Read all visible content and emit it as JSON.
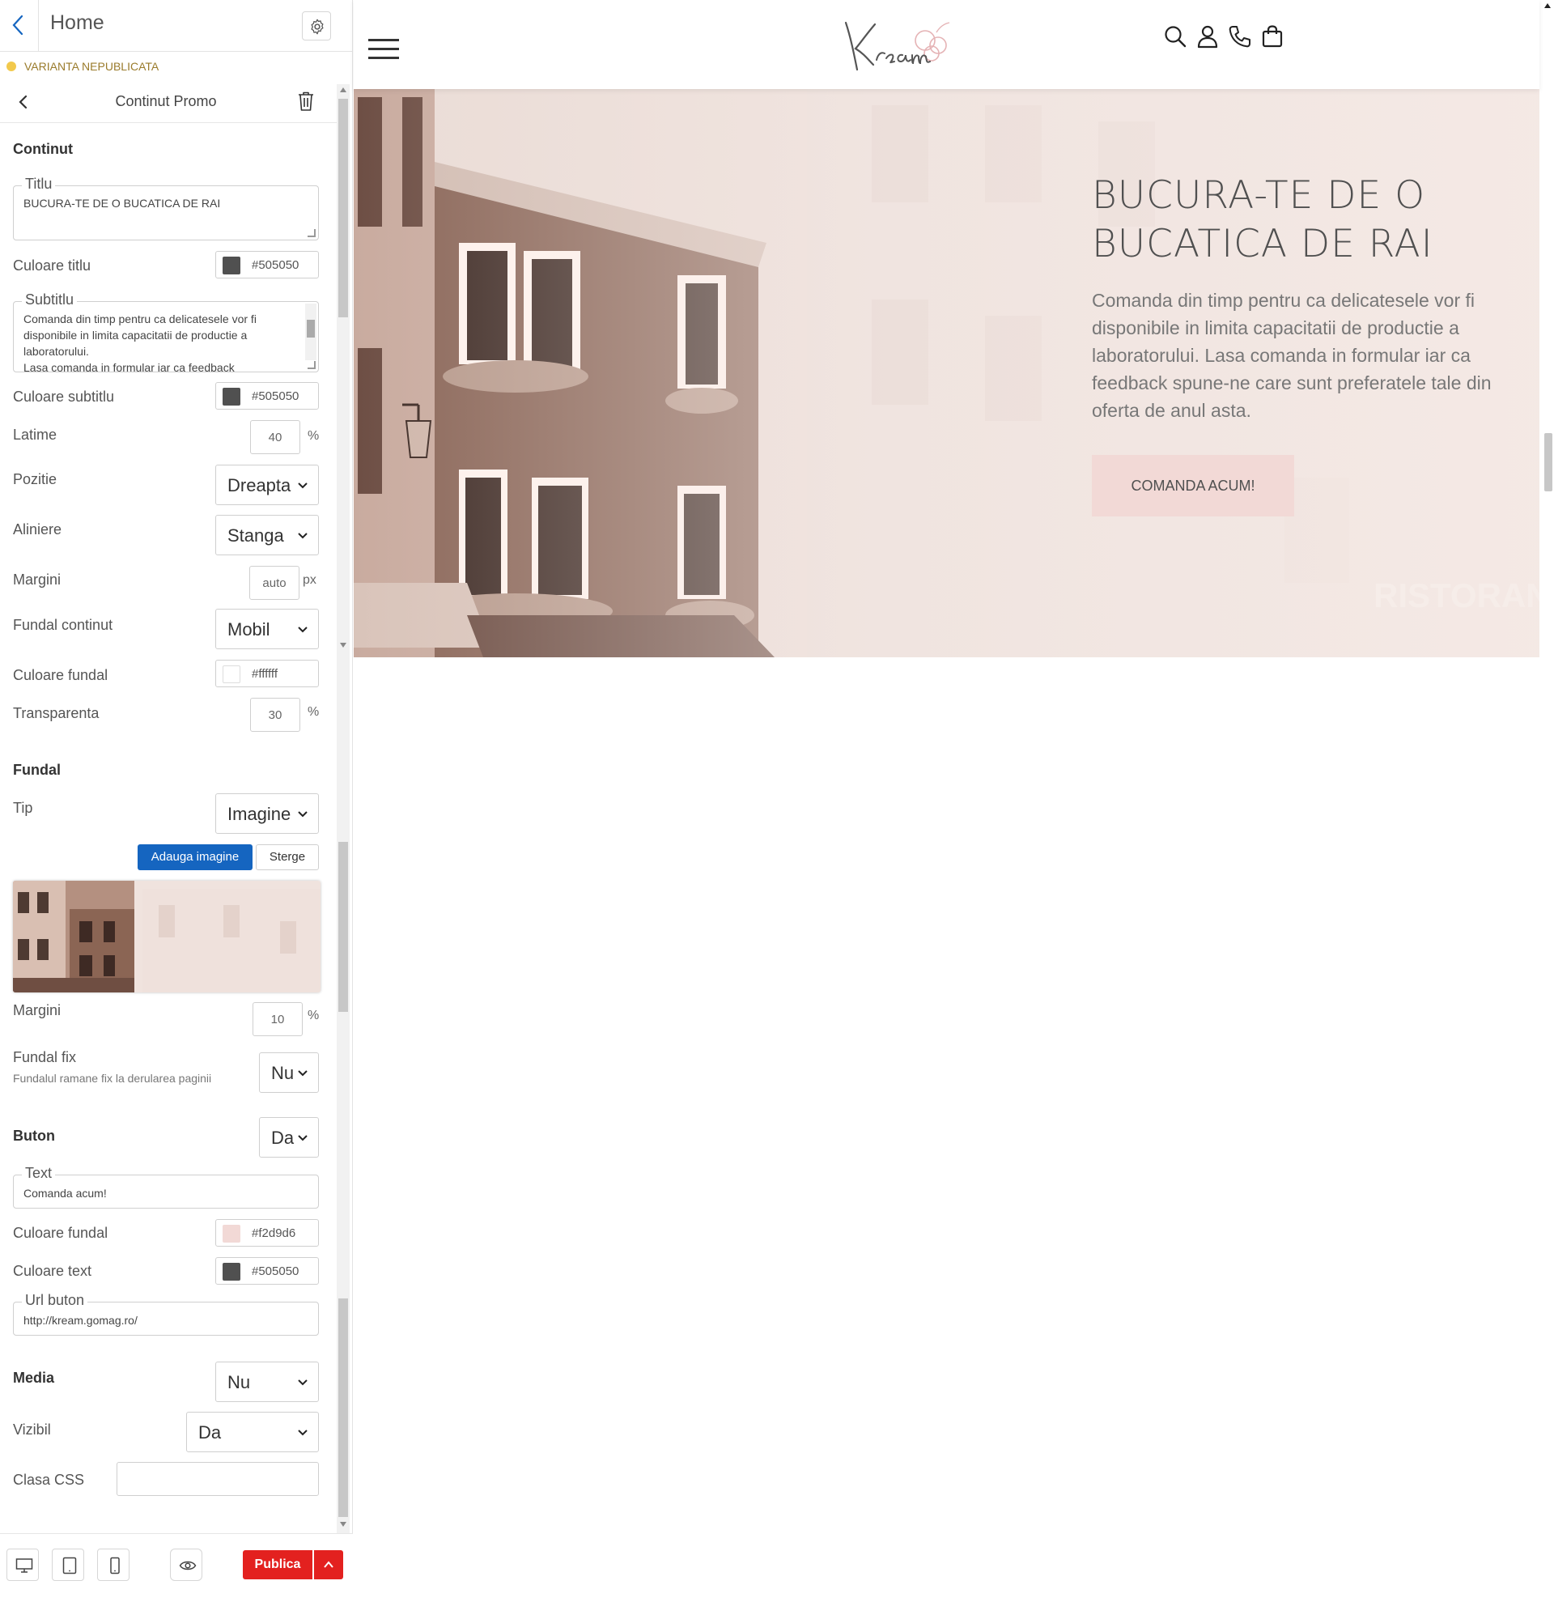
{
  "editor": {
    "title": "Home",
    "status": "VARIANTA NEPUBLICATA",
    "section_title": "Continut Promo",
    "continut": {
      "heading": "Continut",
      "titlu_legend": "Titlu",
      "titlu_value": "BUCURA-TE DE O BUCATICA DE RAI",
      "culoare_titlu_label": "Culoare titlu",
      "culoare_titlu_value": "#505050",
      "subtitlu_legend": "Subtitlu",
      "subtitlu_line1": "Comanda din timp pentru ca delicatesele vor fi",
      "subtitlu_line2": "disponibile in limita capacitatii de productie a",
      "subtitlu_line3": "laboratorului.",
      "subtitlu_line4": "Lasa comanda in formular iar ca feedback",
      "culoare_subtitlu_label": "Culoare subtitlu",
      "culoare_subtitlu_value": "#505050",
      "latime_label": "Latime",
      "latime_value": "40",
      "latime_unit": "%",
      "pozitie_label": "Pozitie",
      "pozitie_value": "Dreapta",
      "aliniere_label": "Aliniere",
      "aliniere_value": "Stanga",
      "margini_label": "Margini",
      "margini_value": "auto",
      "margini_unit": "px",
      "fundal_continut_label": "Fundal continut",
      "fundal_continut_value": "Mobil",
      "culoare_fundal_label": "Culoare fundal",
      "culoare_fundal_value": "#ffffff",
      "transparenta_label": "Transparenta",
      "transparenta_value": "30",
      "transparenta_unit": "%"
    },
    "fundal": {
      "heading": "Fundal",
      "tip_label": "Tip",
      "tip_value": "Imagine",
      "add_image": "Adauga imagine",
      "delete": "Sterge",
      "margini_label": "Margini",
      "margini_value": "10",
      "margini_unit": "%",
      "fix_label": "Fundal fix",
      "fix_note": "Fundalul ramane fix la derularea paginii",
      "fix_value": "Nu"
    },
    "buton": {
      "heading": "Buton",
      "enabled": "Da",
      "text_legend": "Text",
      "text_value": "Comanda acum!",
      "culoare_fundal_label": "Culoare fundal",
      "culoare_fundal_value": "#f2d9d6",
      "culoare_text_label": "Culoare text",
      "culoare_text_value": "#505050",
      "url_legend": "Url buton",
      "url_value": "http://kream.gomag.ro/"
    },
    "media": {
      "label": "Media",
      "value": "Nu"
    },
    "vizibil": {
      "label": "Vizibil",
      "value": "Da"
    },
    "clasa_css": {
      "label": "Clasa CSS",
      "value": ""
    },
    "publish": "Publica"
  },
  "preview": {
    "logo_text": "Kream",
    "hero": {
      "title_line1": "BUCURA-TE DE O",
      "title_line2": "BUCATICA DE RAI",
      "subtitle": "Comanda din timp pentru ca delicatesele vor fi disponibile in limita capacitatii de productie a laboratorului. Lasa comanda in formular iar ca feedback spune-ne care sunt preferatele tale din oferta de anul asta.",
      "button": "COMANDA ACUM!",
      "sign_text": "RISTORANTE"
    }
  },
  "colors": {
    "accent_blue": "#1565c0",
    "publish_red": "#e3211f",
    "title_color": "#505050",
    "button_bg": "#f2d9d6",
    "status_dot": "#f2c94c"
  },
  "icons": [
    "back-chevron-icon",
    "gear-icon",
    "chevron-left-icon",
    "trash-icon",
    "desktop-icon",
    "tablet-icon",
    "mobile-icon",
    "eye-icon",
    "chevron-up-icon",
    "menu-icon",
    "search-icon",
    "user-icon",
    "phone-icon",
    "bag-icon"
  ]
}
